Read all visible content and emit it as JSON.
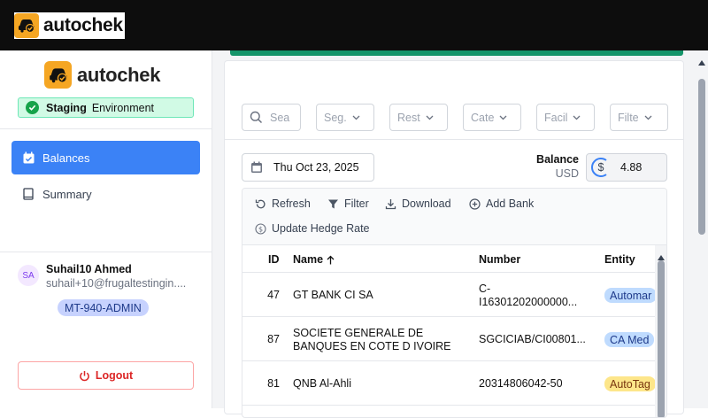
{
  "brand": {
    "name": "autochek"
  },
  "sidebar": {
    "env": {
      "name": "Staging",
      "label": "Environment"
    },
    "nav": [
      {
        "label": "Balances"
      },
      {
        "label": "Summary"
      }
    ],
    "user": {
      "initials": "SA",
      "name": "Suhail10 Ahmed",
      "email": "suhail+10@frugaltestingin....",
      "role": "MT-940-ADMIN"
    },
    "logout": "Logout"
  },
  "filters": [
    "Sea",
    "Seg.",
    "Rest",
    "Cate",
    "Facil",
    "Filte"
  ],
  "date": "Thu Oct 23, 2025",
  "balance": {
    "label": "Balance",
    "currency": "USD",
    "symbol": "$",
    "value": "4.88"
  },
  "toolbar": {
    "refresh": "Refresh",
    "filter": "Filter",
    "download": "Download",
    "add_bank": "Add Bank",
    "update_hedge": "Update Hedge Rate"
  },
  "table": {
    "headers": {
      "id": "ID",
      "name": "Name",
      "number": "Number",
      "entity": "Entity"
    },
    "rows": [
      {
        "id": "47",
        "name": [
          "GT BANK CI SA"
        ],
        "number": [
          "C-",
          "I16301202000000..."
        ],
        "entity": "Automar",
        "entity_color": "blue"
      },
      {
        "id": "87",
        "name": [
          "SOCIETE GENERALE DE",
          "BANQUES EN COTE D IVOIRE"
        ],
        "number": [
          "SGCICIAB/CI00801..."
        ],
        "entity": "CA Med",
        "entity_color": "blue"
      },
      {
        "id": "81",
        "name": [
          "QNB Al-Ahli"
        ],
        "number": [
          "20314806042-50"
        ],
        "entity": "AutoTag",
        "entity_color": "yellow"
      }
    ]
  },
  "colors": {
    "accent": "#3b82f6",
    "brand_orange": "#f5a623",
    "strip_green": "#15956a",
    "danger": "#dc2626"
  }
}
